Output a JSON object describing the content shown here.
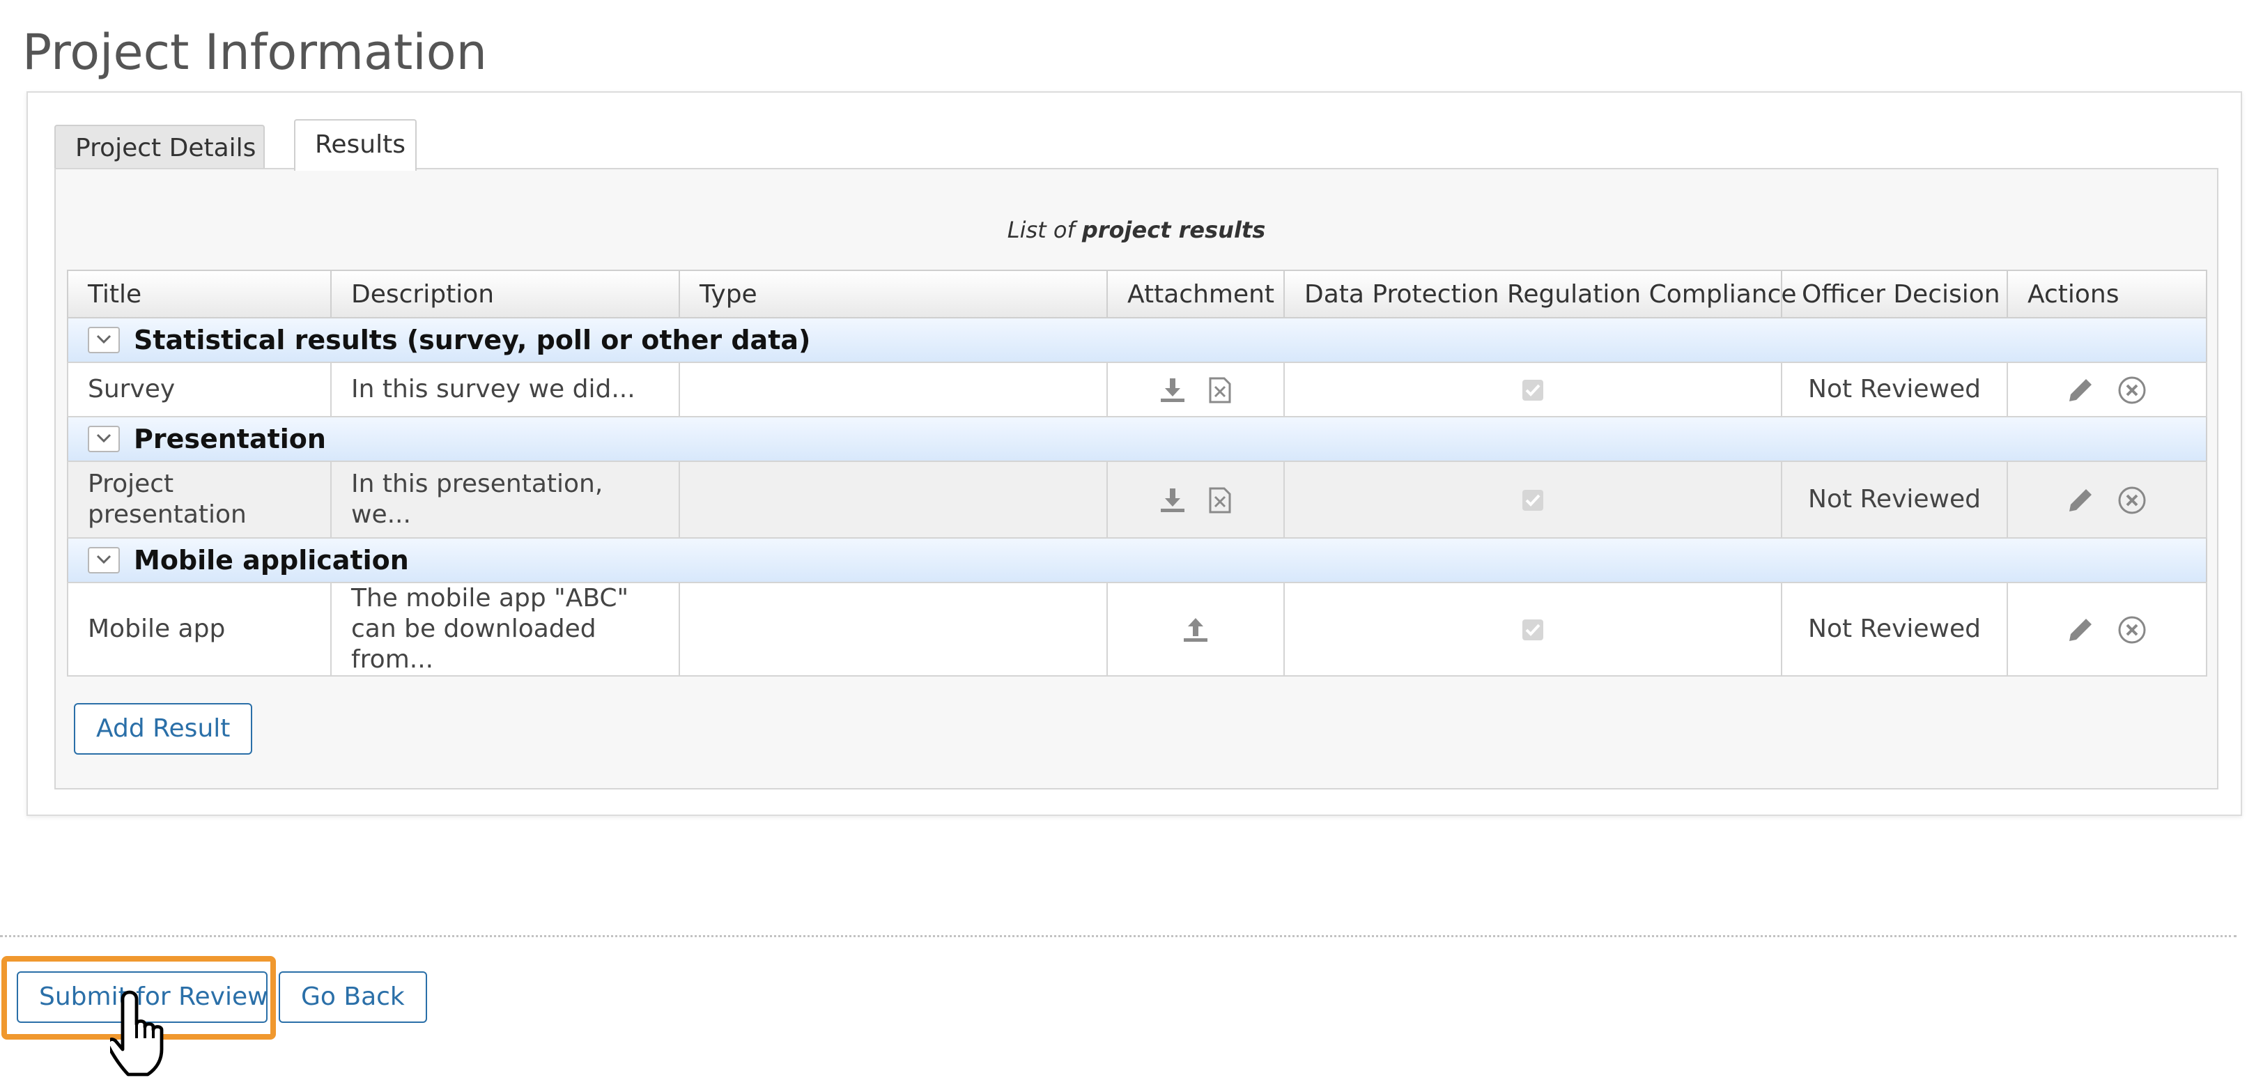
{
  "page": {
    "title": "Project Information"
  },
  "tabs": [
    {
      "label": "Project Details",
      "active": false
    },
    {
      "label": "Results",
      "active": true
    }
  ],
  "results": {
    "caption_prefix": "List of ",
    "caption_bold": "project results",
    "columns": [
      "Title",
      "Description",
      "Type",
      "Attachment",
      "Data Protection Regulation Compliance",
      "Officer Decision",
      "Actions"
    ],
    "groups": [
      {
        "name": "Statistical results (survey, poll or other data)",
        "rows": [
          {
            "title": "Survey",
            "description": "In this survey we did...",
            "type": "",
            "attachment_icons": [
              "download-icon",
              "remove-file-icon"
            ],
            "compliance_checked": true,
            "decision": "Not Reviewed"
          }
        ]
      },
      {
        "name": "Presentation",
        "rows": [
          {
            "title": "Project presentation",
            "description": "In this presentation, we...",
            "type": "",
            "attachment_icons": [
              "download-icon",
              "remove-file-icon"
            ],
            "compliance_checked": true,
            "decision": "Not Reviewed"
          }
        ]
      },
      {
        "name": "Mobile application",
        "rows": [
          {
            "title": "Mobile app",
            "description": "The mobile app \"ABC\" can be downloaded from...",
            "type": "",
            "attachment_icons": [
              "upload-icon"
            ],
            "compliance_checked": true,
            "decision": "Not Reviewed"
          }
        ]
      }
    ],
    "add_button": "Add Result"
  },
  "footer": {
    "submit_button": "Submit for Review",
    "back_button": "Go Back"
  },
  "colors": {
    "accent": "#2a6fa8",
    "group_row": "#d8e8fb",
    "highlight": "#f0982e"
  }
}
